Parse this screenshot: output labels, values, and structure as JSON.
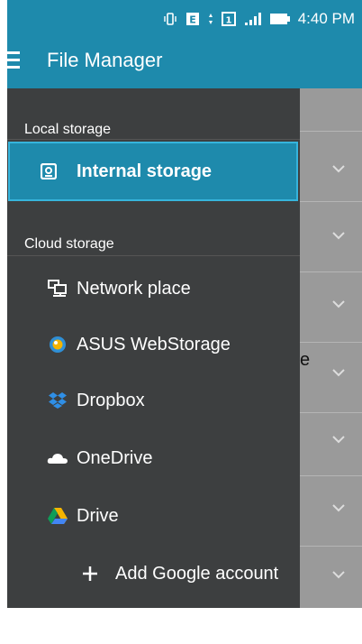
{
  "status_bar": {
    "time": "4:40 PM"
  },
  "app_bar": {
    "title": "File Manager"
  },
  "drawer": {
    "local_section": "Local storage",
    "internal_storage": "Internal storage",
    "cloud_section": "Cloud storage",
    "cloud_items": [
      {
        "label": "Network place",
        "icon": "network-place-icon"
      },
      {
        "label": "ASUS WebStorage",
        "icon": "asus-webstorage-icon"
      },
      {
        "label": "Dropbox",
        "icon": "dropbox-icon"
      },
      {
        "label": "OneDrive",
        "icon": "onedrive-icon"
      },
      {
        "label": "Drive",
        "icon": "google-drive-icon"
      }
    ],
    "add_account": "Add Google account"
  },
  "background": {
    "partial_text": "e"
  },
  "colors": {
    "accent": "#1e8aac",
    "drawer_bg": "#3d3f40",
    "selected_border": "#36b4dc"
  }
}
